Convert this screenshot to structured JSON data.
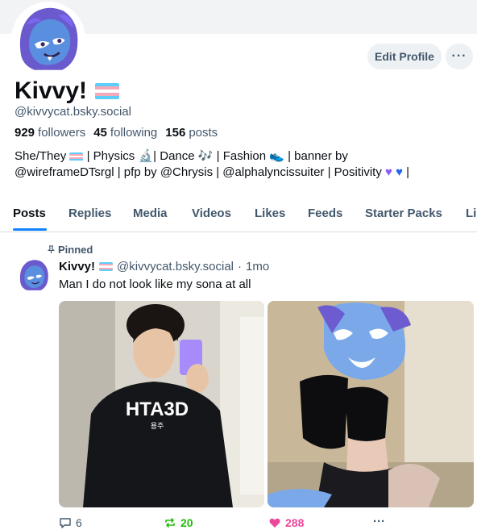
{
  "profile": {
    "display_name": "Kivvy!",
    "handle": "@kivvycat.bsky.social",
    "followers_count": "929",
    "followers_label": "followers",
    "following_count": "45",
    "following_label": "following",
    "posts_count": "156",
    "posts_label": "posts",
    "bio_line1_parts": [
      "She/They",
      "| Physics",
      "| Dance",
      "| Fashion",
      "| banner by"
    ],
    "bio_line2_parts": [
      "@wireframeDTsrgl | pfp by @Chrysis | @alphalyncissuiter | Positivity",
      "|"
    ],
    "edit_button": "Edit Profile",
    "more_button": "···"
  },
  "tabs": [
    "Posts",
    "Replies",
    "Media",
    "Videos",
    "Likes",
    "Feeds",
    "Starter Packs",
    "Lis"
  ],
  "active_tab": "Posts",
  "post": {
    "pinned_label": "Pinned",
    "author": "Kivvy!",
    "handle": "@kivvycat.bsky.social",
    "separator": "·",
    "time": "1mo",
    "text": "Man I do not look like my sona at all",
    "image1_text": "HTA3D",
    "image1_subtext": "용주",
    "replies": "6",
    "reposts": "20",
    "likes": "288",
    "more": "···"
  },
  "colors": {
    "accent": "#1083fe",
    "repost_green": "#20bc07",
    "like_pink": "#ec4899",
    "muted_text": "#42576c",
    "trans_flag": [
      "#5bcefa",
      "#f5a9b8",
      "#ffffff",
      "#f5a9b8",
      "#5bcefa"
    ]
  },
  "icons": [
    "pin-icon",
    "reply-icon",
    "repost-icon",
    "heart-icon",
    "more-icon",
    "microscope-icon",
    "music-notes-icon",
    "sneaker-icon",
    "purple-heart-icon",
    "blue-heart-icon"
  ]
}
